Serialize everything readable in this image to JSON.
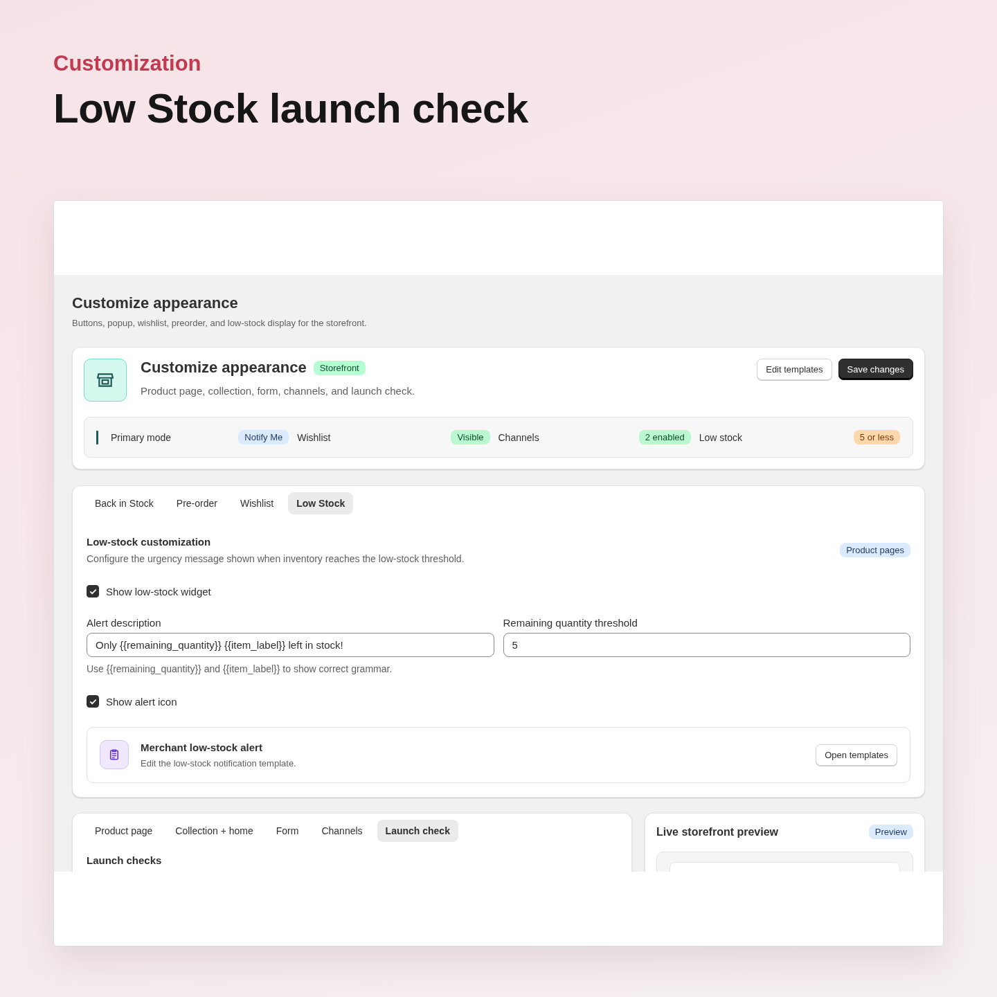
{
  "eyebrow": "Customization",
  "headline": "Low Stock launch check",
  "page": {
    "title": "Customize appearance",
    "subtitle": "Buttons, popup, wishlist, preorder, and low-stock display for the storefront."
  },
  "summary_card": {
    "title": "Customize appearance",
    "badge": "Storefront",
    "description": "Product page, collection, form, channels, and launch check.",
    "buttons": [
      {
        "label": "Edit templates",
        "kind": "secondary"
      },
      {
        "label": "Save changes",
        "kind": "primary"
      }
    ],
    "stats": [
      {
        "label": "Primary mode",
        "value": "Notify Me",
        "color": "#dbeafe"
      },
      {
        "label": "Wishlist",
        "value": "Visible",
        "color": "#bbf7d0"
      },
      {
        "label": "Channels",
        "value": "2 enabled",
        "color": "#bbf7d0"
      },
      {
        "label": "Low stock",
        "value": "5 or less",
        "color": "#fed7aa"
      }
    ]
  },
  "settings_card": {
    "tabs": [
      {
        "label": "Back in Stock",
        "selected": false
      },
      {
        "label": "Pre-order",
        "selected": false
      },
      {
        "label": "Wishlist",
        "selected": false
      },
      {
        "label": "Low Stock",
        "selected": true
      }
    ],
    "section_title": "Low-stock customization",
    "section_description": "Configure the urgency message shown when inventory reaches the low-stock threshold.",
    "section_badge": "Product pages",
    "widget_checkbox": {
      "label": "Show low-stock widget",
      "checked": true
    },
    "fields": [
      {
        "label": "Alert description",
        "value": "Only {{remaining_quantity}} {{item_label}} left in stock!"
      },
      {
        "label": "Remaining quantity threshold",
        "value": "5"
      }
    ],
    "help_text": "Use {{remaining_quantity}} and {{item_label}} to show correct grammar.",
    "icon_checkbox": {
      "label": "Show alert icon",
      "checked": true
    },
    "alert_row": {
      "title": "Merchant low-stock alert",
      "description": "Edit the low-stock notification template.",
      "button": "Open templates"
    }
  },
  "launch_card": {
    "tabs": [
      {
        "label": "Product page",
        "selected": false
      },
      {
        "label": "Collection + home",
        "selected": false
      },
      {
        "label": "Form",
        "selected": false
      },
      {
        "label": "Channels",
        "selected": false
      },
      {
        "label": "Launch check",
        "selected": true
      }
    ],
    "heading": "Launch checks"
  },
  "preview_card": {
    "title": "Live storefront preview",
    "badge": "Preview"
  }
}
